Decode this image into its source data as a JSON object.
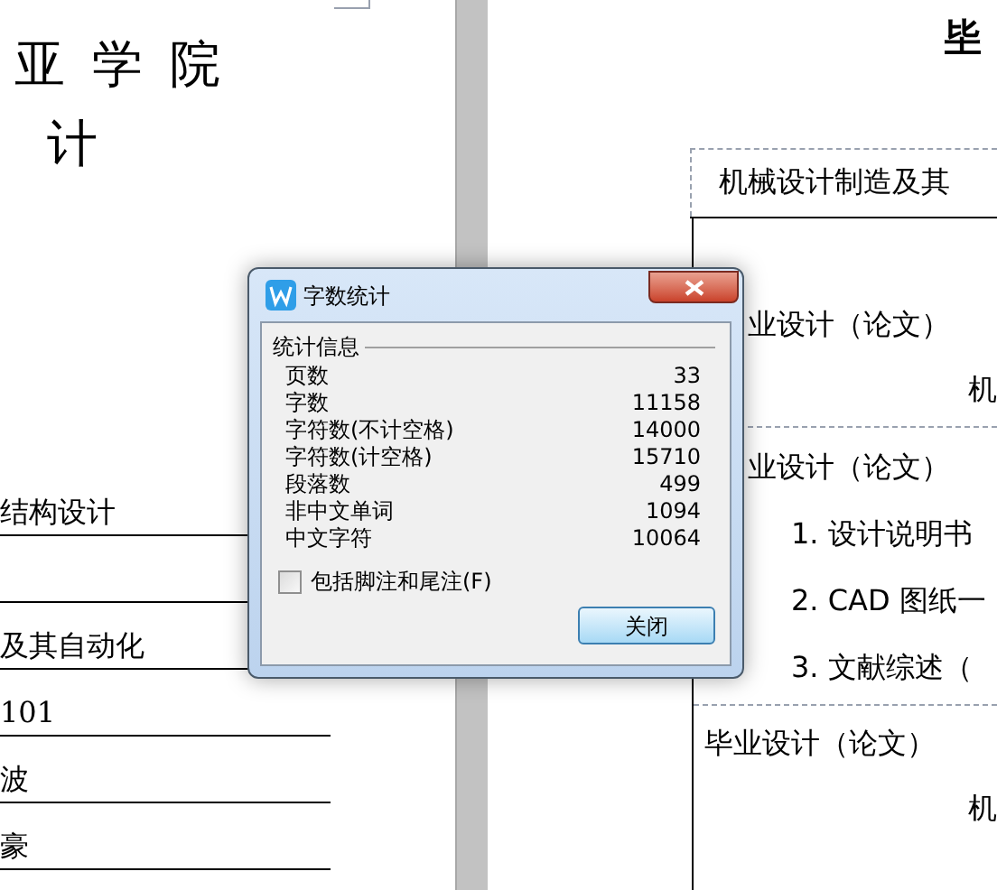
{
  "left_page": {
    "headings": [
      "亚 学 院",
      "计"
    ],
    "fields": [
      {
        "value": "结构设计",
        "kind": "long"
      },
      {
        "kind": "long"
      },
      {
        "value": "及其自动化",
        "kind": "long"
      },
      {
        "value": "101",
        "kind": "short"
      },
      {
        "value": "波",
        "kind": "short"
      },
      {
        "value": "豪",
        "kind": "short"
      }
    ]
  },
  "right_page": {
    "header": "毕",
    "table_head": "机械设计制造及其",
    "lines": [
      {
        "text": "业设计（论文）",
        "kind": "label"
      },
      {
        "text": "机",
        "kind": "value"
      },
      {
        "text": "业设计（论文）",
        "kind": "label",
        "rule": true
      },
      {
        "text": "1. 设计说明书",
        "kind": "item"
      },
      {
        "text": "2. CAD 图纸一",
        "kind": "item"
      },
      {
        "text": "3. 文献综述（",
        "kind": "item"
      },
      {
        "text": "毕业设计（论文）",
        "kind": "label_full",
        "rule": true
      },
      {
        "text": "机",
        "kind": "value"
      }
    ]
  },
  "dialog": {
    "title": "字数统计",
    "section": "统计信息",
    "stats": [
      {
        "label": "页数",
        "value": "33"
      },
      {
        "label": "字数",
        "value": "11158"
      },
      {
        "label": "字符数(不计空格)",
        "value": "14000"
      },
      {
        "label": "字符数(计空格)",
        "value": "15710"
      },
      {
        "label": "段落数",
        "value": "499"
      },
      {
        "label": "非中文单词",
        "value": "1094"
      },
      {
        "label": "中文字符",
        "value": "10064"
      }
    ],
    "checkbox": {
      "label": "包括脚注和尾注(F)",
      "checked": false
    },
    "button": "关闭"
  }
}
